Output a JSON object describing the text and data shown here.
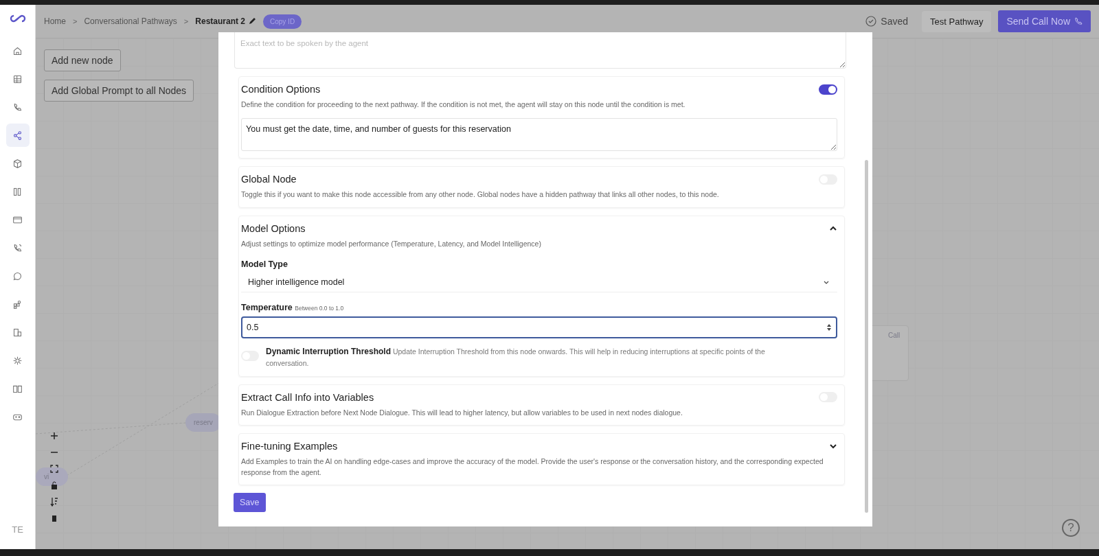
{
  "sidebar": {
    "items": [
      {
        "selected": false
      },
      {
        "selected": false
      },
      {
        "selected": false
      },
      {
        "selected": true
      },
      {
        "selected": false
      },
      {
        "selected": false
      },
      {
        "selected": false
      },
      {
        "selected": false
      },
      {
        "selected": false
      },
      {
        "selected": false
      },
      {
        "selected": false
      },
      {
        "selected": false
      },
      {
        "selected": false
      },
      {
        "selected": false
      }
    ],
    "user_initials": "TE"
  },
  "header": {
    "breadcrumbs": [
      {
        "label": "Home",
        "current": false
      },
      {
        "label": "Conversational Pathways",
        "current": false
      },
      {
        "label": "Restaurant 2",
        "current": true
      }
    ],
    "separator": ">",
    "copy_id": "Copy ID",
    "status": "Saved",
    "test_button": "Test Pathway",
    "send_button": "Send Call Now"
  },
  "canvas": {
    "buttons": [
      "Add new node",
      "Add Global Prompt to all Nodes"
    ],
    "nodes": [
      "reserv",
      "vi",
      "Call"
    ]
  },
  "modal": {
    "prompt_field": {
      "placeholder": "Exact text to be spoken by the agent"
    },
    "sections": [
      {
        "kind": "toggle",
        "title": "Condition Options",
        "description": "Define the condition for proceeding to the next pathway. If the condition is not met, the agent will stay on this node until the condition is met.",
        "on": true,
        "value": "You must get the date, time, and number of guests for this reservation"
      },
      {
        "kind": "toggle",
        "title": "Global Node",
        "description": "Toggle this if you want to make this node accessible from any other node. Global nodes have a hidden pathway that links all other nodes, to this node.",
        "on": false
      },
      {
        "kind": "collapsible",
        "title": "Model Options",
        "description": "Adjust settings to optimize model performance (Temperature, Latency, and Model Intelligence)",
        "expanded": true,
        "model_type": {
          "label": "Model Type",
          "value": "Higher intelligence model"
        },
        "temperature": {
          "label": "Temperature",
          "hint": "Between 0.0 to 1.0",
          "value": "0.5"
        },
        "dynamic_threshold": {
          "title": "Dynamic Interruption Threshold",
          "description": "Update Interruption Threshold from this node onwards. This will help in reducing interruptions at specific points of the conversation.",
          "on": false
        }
      },
      {
        "kind": "toggle",
        "title": "Extract Call Info into Variables",
        "description": "Run Dialogue Extraction before Next Node Dialogue. This will lead to higher latency, but allow variables to be used in next nodes dialogue.",
        "on": false
      },
      {
        "kind": "collapsible",
        "title": "Fine-tuning Examples",
        "description": "Add Examples to train the AI on handling edge-cases and improve the accuracy of the model. Provide the user's response or the conversation history, and the corresponding expected response from the agent.",
        "expanded": false
      }
    ],
    "save_button": "Save"
  },
  "help": "?"
}
